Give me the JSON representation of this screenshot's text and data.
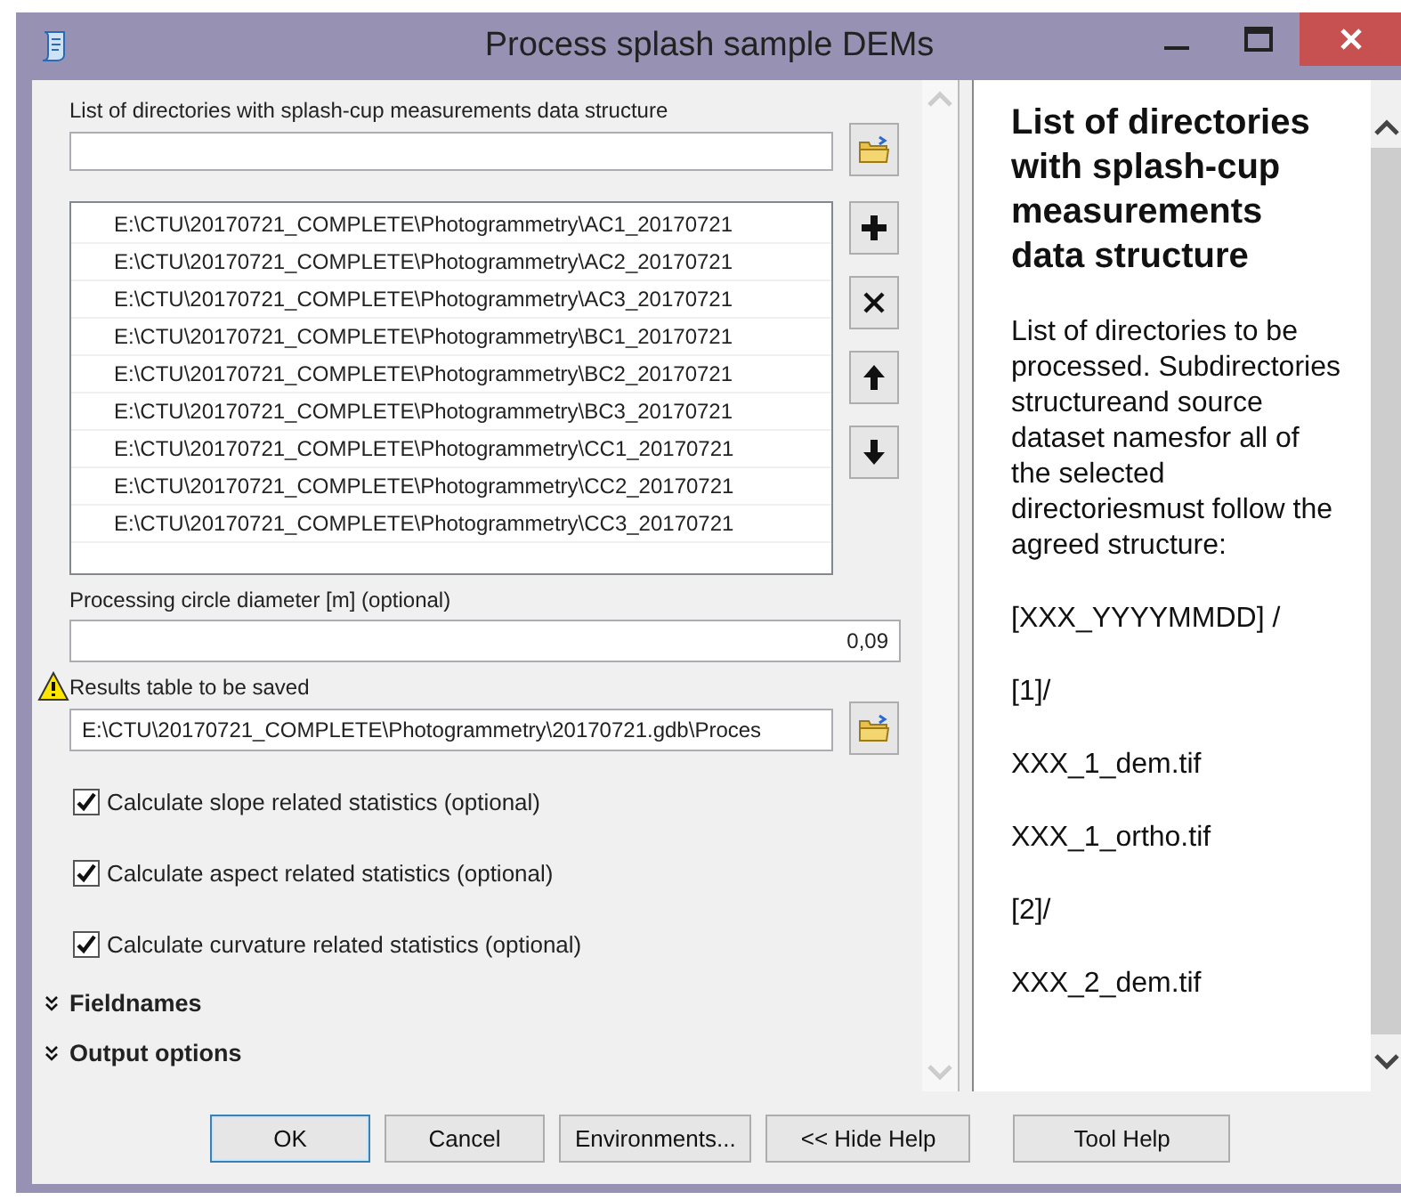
{
  "window": {
    "title": "Process splash sample DEMs"
  },
  "directories": {
    "label": "List of directories with splash-cup measurements data structure",
    "items": [
      "E:\\CTU\\20170721_COMPLETE\\Photogrammetry\\AC1_20170721",
      "E:\\CTU\\20170721_COMPLETE\\Photogrammetry\\AC2_20170721",
      "E:\\CTU\\20170721_COMPLETE\\Photogrammetry\\AC3_20170721",
      "E:\\CTU\\20170721_COMPLETE\\Photogrammetry\\BC1_20170721",
      "E:\\CTU\\20170721_COMPLETE\\Photogrammetry\\BC2_20170721",
      "E:\\CTU\\20170721_COMPLETE\\Photogrammetry\\BC3_20170721",
      "E:\\CTU\\20170721_COMPLETE\\Photogrammetry\\CC1_20170721",
      "E:\\CTU\\20170721_COMPLETE\\Photogrammetry\\CC2_20170721",
      "E:\\CTU\\20170721_COMPLETE\\Photogrammetry\\CC3_20170721"
    ]
  },
  "diameter": {
    "label": "Processing circle diameter [m] (optional)",
    "value": "0,09"
  },
  "results": {
    "label": "Results table to be saved",
    "warning": true,
    "value": "E:\\CTU\\20170721_COMPLETE\\Photogrammetry\\20170721.gdb\\Proces"
  },
  "checkboxes": [
    {
      "label": "Calculate slope related statistics (optional)",
      "checked": true
    },
    {
      "label": "Calculate aspect related statistics (optional)",
      "checked": true
    },
    {
      "label": "Calculate curvature related statistics (optional)",
      "checked": true
    }
  ],
  "sections": [
    {
      "label": "Fieldnames",
      "expanded": false
    },
    {
      "label": "Output options",
      "expanded": false
    }
  ],
  "help": {
    "title": "List of directories with splash-cup measurements data structure",
    "paragraphs": [
      "List of directories to be processed. Subdirectories structureand source dataset namesfor all of the selected directoriesmust follow the agreed structure:",
      "[XXX_YYYYMMDD] /",
      "[1]/",
      "XXX_1_dem.tif",
      "XXX_1_ortho.tif",
      "[2]/",
      "XXX_2_dem.tif"
    ]
  },
  "buttons": [
    {
      "label": "OK",
      "default": true
    },
    {
      "label": "Cancel",
      "default": false
    },
    {
      "label": "Environments...",
      "default": false
    },
    {
      "label": "<< Hide Help",
      "default": false
    },
    {
      "label": "Tool Help",
      "default": false
    }
  ]
}
